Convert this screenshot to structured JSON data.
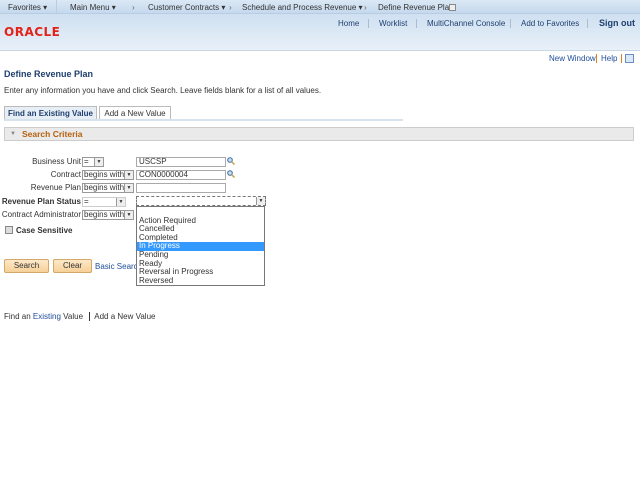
{
  "breadcrumbs": [
    {
      "label": "Favorites ▾"
    },
    {
      "label": "Main Menu ▾"
    },
    {
      "label": "Customer Contracts ▾"
    },
    {
      "label": "Schedule and Process Revenue ▾"
    },
    {
      "label": "Define Revenue Plan"
    }
  ],
  "header": {
    "nav": [
      "Home",
      "Worklist",
      "MultiChannel Console",
      "Add to Favorites",
      "Sign out"
    ],
    "logo": "ORACLE"
  },
  "toolbar": {
    "new_window": "New Window",
    "help": "Help"
  },
  "page": {
    "title": "Define Revenue Plan",
    "instructions": "Enter any information you have and click Search. Leave fields blank for a list of all values."
  },
  "tabs": [
    {
      "label": "Find an Existing Value",
      "active": true
    },
    {
      "label": "Add a New Value",
      "active": false
    }
  ],
  "search_criteria": {
    "title": "Search Criteria",
    "fields": [
      {
        "label": "Business Unit",
        "operator": "=",
        "value": "USCSP"
      },
      {
        "label": "Contract",
        "operator": "begins with",
        "value": "CON0000004"
      },
      {
        "label": "Revenue Plan",
        "operator": "begins with",
        "value": ""
      },
      {
        "label": "Revenue Plan Status",
        "operator": "=",
        "value": ""
      },
      {
        "label": "Contract Administrator",
        "operator": "begins with",
        "value": ""
      }
    ],
    "case_sensitive": "Case Sensitive",
    "status_options": [
      "",
      "Action Required",
      "Cancelled",
      "Completed",
      "In Progress",
      "Pending",
      "Ready",
      "Reversal in Progress",
      "Reversed"
    ],
    "highlighted_option": "In Progress"
  },
  "buttons": {
    "search": "Search",
    "clear": "Clear",
    "basic_search": "Basic Search"
  },
  "footer": {
    "find_prefix": "Find an ",
    "find_link": "Existing",
    "find_suffix": " Value",
    "add_new": "Add a New Value"
  },
  "colors": {
    "highlight": "#3399ff",
    "link": "#1f4c9a",
    "oracle_red": "#e2231a"
  }
}
